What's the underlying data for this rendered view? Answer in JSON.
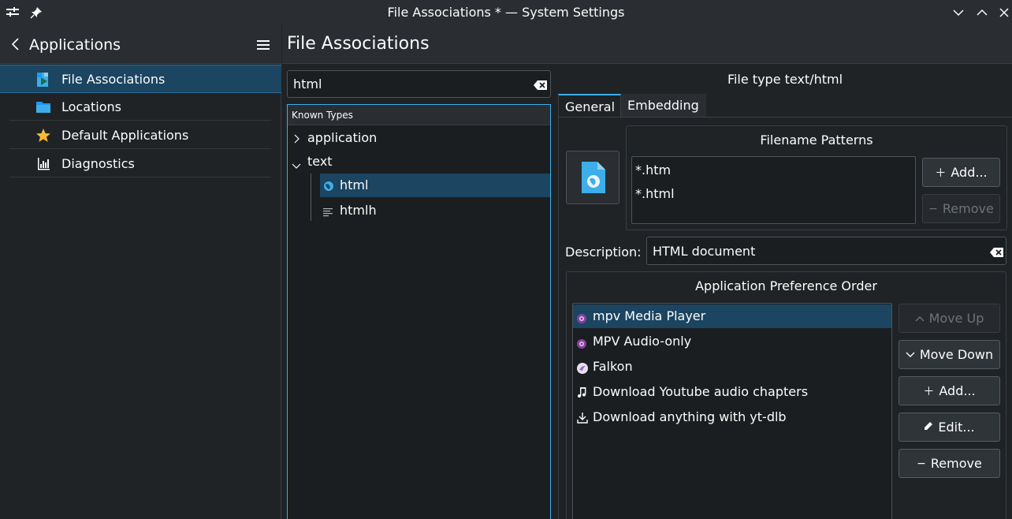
{
  "window": {
    "title": "File Associations * — System Settings"
  },
  "sidebar": {
    "title": "Applications",
    "items": [
      {
        "label": "File Associations",
        "icon": "file-associations-icon",
        "selected": true
      },
      {
        "label": "Locations",
        "icon": "folder-icon",
        "selected": false
      },
      {
        "label": "Default Applications",
        "icon": "star-icon",
        "selected": false
      },
      {
        "label": "Diagnostics",
        "icon": "diagnostics-icon",
        "selected": false
      }
    ]
  },
  "main": {
    "title": "File Associations",
    "search": {
      "value": "html"
    },
    "tree": {
      "header": "Known Types",
      "items": [
        {
          "label": "application",
          "expanded": false
        },
        {
          "label": "text",
          "expanded": true
        },
        {
          "label": "html",
          "icon": "globe-icon",
          "selected": true
        },
        {
          "label": "htmlh",
          "icon": "text-lines-icon",
          "selected": false
        }
      ]
    }
  },
  "details": {
    "file_type": "File type text/html",
    "tabs": [
      {
        "label": "General",
        "active": true
      },
      {
        "label": "Embedding",
        "active": false
      }
    ],
    "patterns": {
      "title": "Filename Patterns",
      "items": [
        "*.htm",
        "*.html"
      ],
      "add_label": "Add...",
      "remove_label": "Remove"
    },
    "description": {
      "label": "Description:",
      "value": "HTML document"
    },
    "app_order": {
      "title": "Application Preference Order",
      "items": [
        {
          "label": "mpv Media Player",
          "icon": "mpv-icon",
          "selected": true
        },
        {
          "label": "MPV Audio-only",
          "icon": "mpv-icon",
          "selected": false
        },
        {
          "label": "Falkon",
          "icon": "falkon-icon",
          "selected": false
        },
        {
          "label": "Download Youtube audio chapters",
          "icon": "music-note-icon",
          "selected": false
        },
        {
          "label": "Download anything with yt-dlb",
          "icon": "download-icon",
          "selected": false
        }
      ],
      "move_up_label": "Move Up",
      "move_down_label": "Move Down",
      "add_label": "Add...",
      "edit_label": "Edit...",
      "remove_label": "Remove"
    }
  },
  "colors": {
    "accent": "#3daee9",
    "selection": "#1b4561",
    "background": "#202326"
  }
}
